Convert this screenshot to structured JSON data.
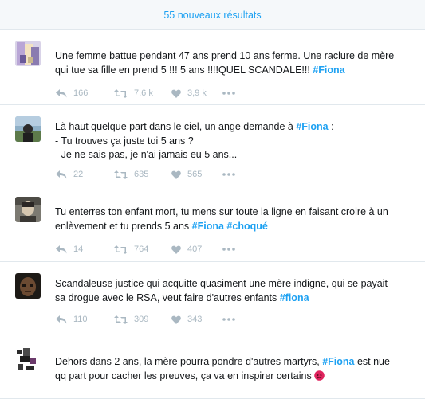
{
  "banner": {
    "label": "55 nouveaux résultats"
  },
  "tweets": [
    {
      "text_parts": [
        "Une femme battue pendant 47 ans prend 10 ans ferme. Une raclure de mère\nqui tue sa fille en prend 5 !!! 5 ans !!!!QUEL SCANDALE!!! ",
        "#Fiona",
        ""
      ],
      "replies": "166",
      "retweets": "7,6 k",
      "likes": "3,9 k"
    },
    {
      "text_parts": [
        "Là haut quelque part dans le ciel, un ange demande à ",
        "#Fiona",
        " :\n- Tu trouves ça juste toi 5 ans ?\n- Je ne sais pas, je n'ai jamais eu 5 ans..."
      ],
      "replies": "22",
      "retweets": "635",
      "likes": "565"
    },
    {
      "text_parts": [
        "Tu enterres ton enfant mort, tu mens sur toute la ligne en faisant croire à un\nenlèvement et tu prends 5 ans ",
        "#Fiona",
        " ",
        "#choqué"
      ],
      "replies": "14",
      "retweets": "764",
      "likes": "407"
    },
    {
      "text_parts": [
        "Scandaleuse justice qui acquitte quasiment une mère indigne, qui se payait\nsa drogue avec le RSA, veut faire d'autres enfants ",
        "#fiona"
      ],
      "replies": "110",
      "retweets": "309",
      "likes": "343"
    },
    {
      "text_parts": [
        "Dehors dans 2 ans, la mère pourra pondre d'autres martyrs, ",
        "#Fiona",
        " est nue\nqq part pour cacher les preuves, ça va en inspirer certains "
      ],
      "emoji": "angry-face-icon"
    }
  ],
  "icons": {
    "reply": "reply-icon",
    "retweet": "retweet-icon",
    "like": "heart-icon",
    "more": "more-icon"
  },
  "colors": {
    "accent": "#1da1f2",
    "muted": "#aab8c2",
    "border": "#e1e8ed",
    "emoji": "#e0245e"
  }
}
